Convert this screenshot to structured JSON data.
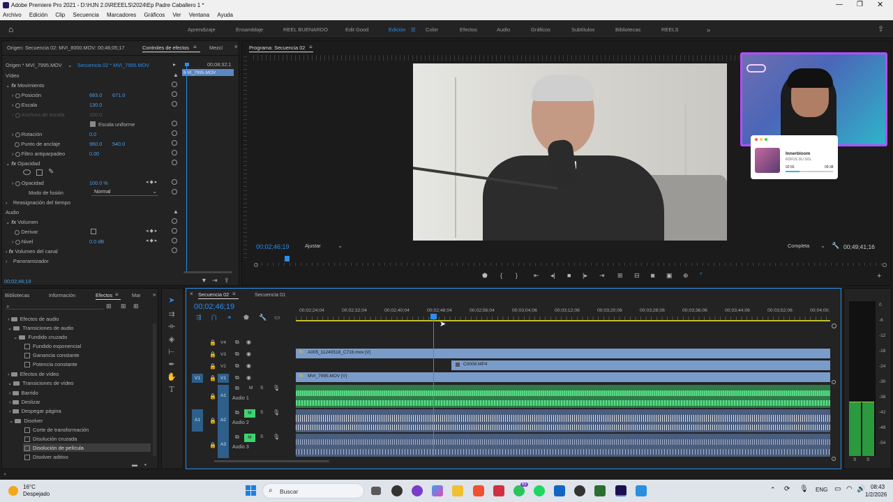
{
  "title_bar": {
    "title": "Adobe Premiere Pro 2021 - D:\\HJN 2.0\\REEELS\\2024\\Ep Padre Caballero 1 *"
  },
  "menu": [
    "Archivo",
    "Edición",
    "Clip",
    "Secuencia",
    "Marcadores",
    "Gráficos",
    "Ver",
    "Ventana",
    "Ayuda"
  ],
  "workspaces": [
    "Aprendizaje",
    "Ensamblaje",
    "REEL BUENARDO",
    "Edit Good",
    "Edición",
    "Color",
    "Efectos",
    "Audio",
    "Gráficos",
    "Subtítulos",
    "Bibliotecas",
    "REELS"
  ],
  "active_workspace": "Edición",
  "effect_controls": {
    "tabs": [
      "Origen: Secuencia 02: MVI_8000.MOV: 00;46;05;17",
      "Controles de efectos",
      "Mezcl"
    ],
    "source": "Origen * MVI_7995.MOV",
    "sequence": "Secuencia 02 * MVI_7995.MOV",
    "mini_time": "00;08;32;1",
    "mini_clip": "MVI_7995.MOV",
    "video_header": "Vídeo",
    "motion": "Movimiento",
    "position_label": "Posición",
    "position_x": "683.0",
    "position_y": "671.0",
    "scale_label": "Escala",
    "scale": "130.0",
    "scale_width_label": "Anchura de escala",
    "scale_width": "100.0",
    "uniform_scale": "Escala uniforme",
    "rotation_label": "Rotación",
    "rotation": "0.0",
    "anchor_label": "Punto de anclaje",
    "anchor_x": "960.0",
    "anchor_y": "540.0",
    "antiflicker_label": "Filtro antiparpadeo",
    "antiflicker": "0.00",
    "opacity_header": "Opacidad",
    "opacity_label": "Opacidad",
    "opacity": "100.0 %",
    "blend_label": "Modo de fusión",
    "blend": "Normal",
    "time_remap": "Reasignación del tiempo",
    "audio_header": "Audio",
    "volume": "Volumen",
    "bypass_label": "Derivar",
    "level_label": "Nivel",
    "level": "0.0 dB",
    "channel_volume": "Volumen del canal",
    "panner": "Panoramizador",
    "timecode": "00;02;46;19"
  },
  "program": {
    "tab": "Programa: Secuencia 02",
    "timecode": "00;02;46;19",
    "fit": "Ajustar",
    "quality": "Completa",
    "duration": "00;49;41;16"
  },
  "overlay": {
    "song": "Innerbloom",
    "artist": "RÜFÜS DU SOL",
    "elapsed": "02:55",
    "total": "09:38",
    "progress": 0.3
  },
  "project": {
    "tabs": [
      "Bibliotecas",
      "Información",
      "Efectos",
      "Mar"
    ],
    "tree": [
      "Efectos de audio",
      "Transiciones de audio",
      "Fundido cruzado",
      "Fundido exponencial",
      "Ganancia constante",
      "Potencia constante",
      "Efectos de vídeo",
      "Transiciones de vídeo",
      "Barrido",
      "Deslizar",
      "Despegar página",
      "Disolver",
      "Corte de transformación",
      "Disolución cruzada",
      "Disolución de película",
      "Disolver aditivo"
    ]
  },
  "timeline": {
    "tabs": [
      "Secuencia 02",
      "Secuencia 01"
    ],
    "timecode": "00;02;46;19",
    "ruler": [
      "00;02;24;04",
      "00;02;32;04",
      "00;02;40;04",
      "00;02;48;04",
      "00;02;56;04",
      "00;03;04;06",
      "00;03;12;06",
      "00;03;20;06",
      "00;03;28;06",
      "00;03;36;06",
      "00;03;44;06",
      "00;03;52;06",
      "00;04;00;"
    ],
    "tracks": [
      "V4",
      "V3",
      "V2",
      "V1",
      "A1",
      "A2",
      "A3"
    ],
    "src_v": "V1",
    "src_a": "A1",
    "audio_names": [
      "Audio 1",
      "Audio 2",
      "Audio 3"
    ],
    "clips": {
      "v3": "A005_11240518_C716.mov [V]",
      "v2": "C0008.MP4",
      "v1": "MVI_7995.MOV [V]"
    },
    "m_label": "M",
    "s_label": "S"
  },
  "meter": {
    "scale": [
      "0",
      "-6",
      "-12",
      "-18",
      "-24",
      "-30",
      "-36",
      "-42",
      "-48",
      "-54"
    ],
    "channels": [
      "S",
      "S"
    ],
    "level_left": 0.1,
    "level_right": 0.1
  },
  "taskbar": {
    "temp": "16°C",
    "weather": "Despejado",
    "search": "Buscar",
    "lang": "ENG",
    "time": "08:43",
    "date": "1/2/2026",
    "badge": "65"
  }
}
